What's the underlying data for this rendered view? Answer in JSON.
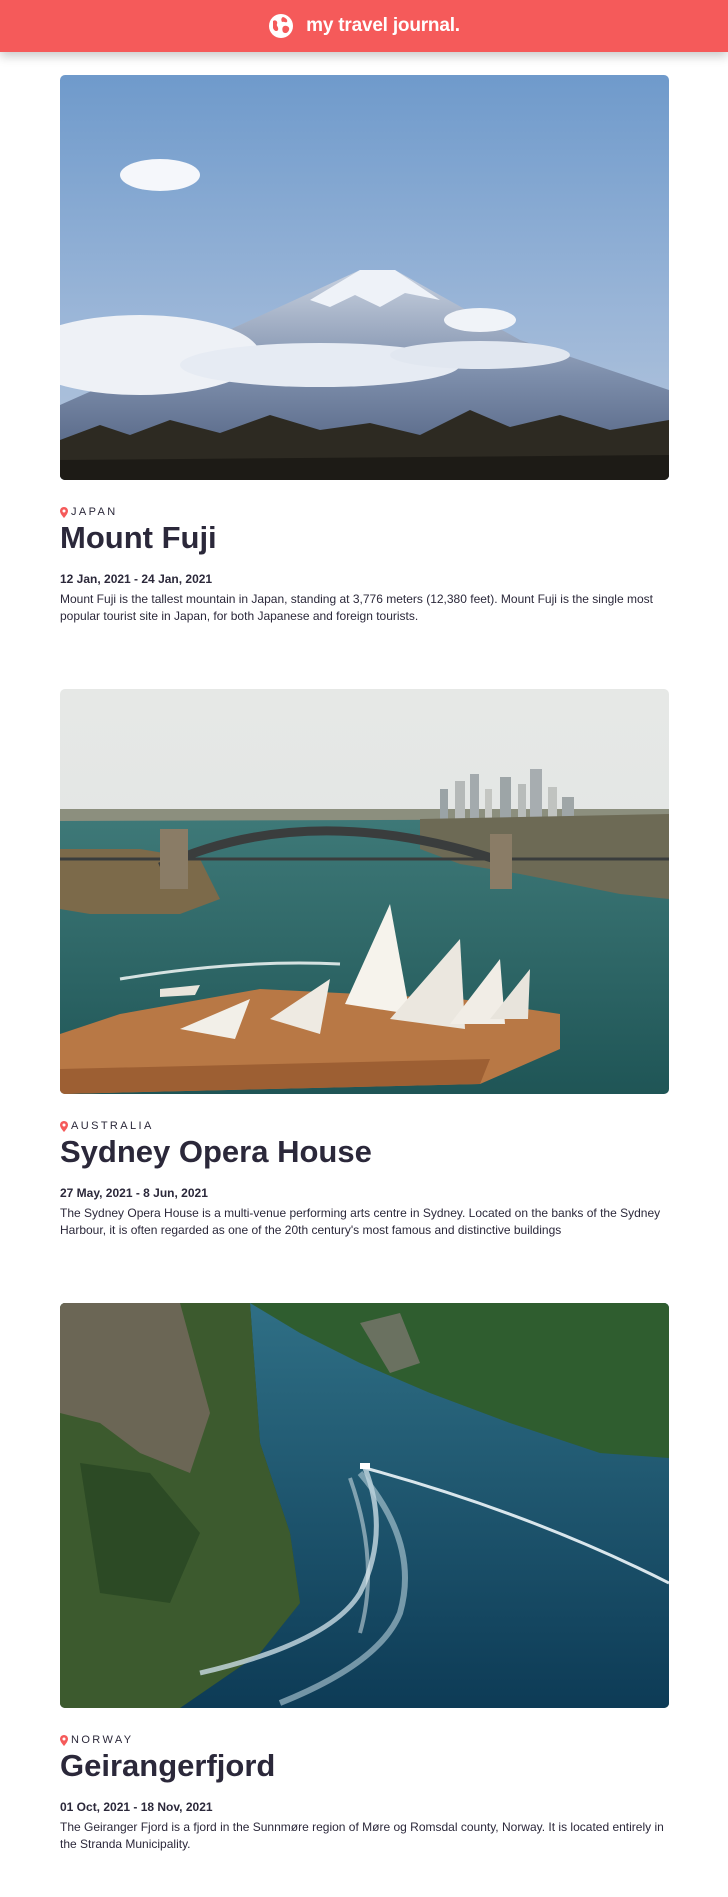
{
  "header": {
    "title": "my travel journal."
  },
  "entries": [
    {
      "location": "JAPAN",
      "title": "Mount Fuji",
      "dates": "12 Jan, 2021 - 24 Jan, 2021",
      "description": "Mount Fuji is the tallest mountain in Japan, standing at 3,776 meters (12,380 feet). Mount Fuji is the single most popular tourist site in Japan, for both Japanese and foreign tourists."
    },
    {
      "location": "AUSTRALIA",
      "title": "Sydney Opera House",
      "dates": "27 May, 2021 - 8 Jun, 2021",
      "description": "The Sydney Opera House is a multi-venue performing arts centre in Sydney. Located on the banks of the Sydney Harbour, it is often regarded as one of the 20th century's most famous and distinctive buildings"
    },
    {
      "location": "NORWAY",
      "title": "Geirangerfjord",
      "dates": "01 Oct, 2021 - 18 Nov, 2021",
      "description": "The Geiranger Fjord is a fjord in the Sunnmøre region of Møre og Romsdal county, Norway. It is located entirely in the Stranda Municipality."
    }
  ],
  "colors": {
    "header_bg": "#f55a5a",
    "text": "#2b283a",
    "pin": "#f55a5a"
  },
  "icons": {
    "header": "globe-icon",
    "location": "map-pin-icon"
  }
}
